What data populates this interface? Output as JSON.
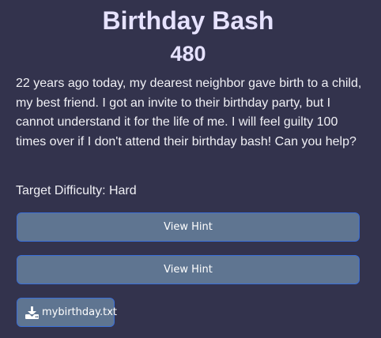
{
  "challenge": {
    "title": "Birthday Bash",
    "points": "480",
    "description": "22 years ago today, my dearest neighbor gave birth to a child, my best friend. I got an invite to their birthday party, but I cannot understand it for the life of me. I will feel guilty 100 times over if I don't attend their birthday bash! Can you help?",
    "difficulty": "Target Difficulty: Hard"
  },
  "hints": [
    {
      "label": "View Hint"
    },
    {
      "label": "View Hint"
    }
  ],
  "files": [
    {
      "name": "mybirthday.txt",
      "icon": "download-icon"
    }
  ]
}
